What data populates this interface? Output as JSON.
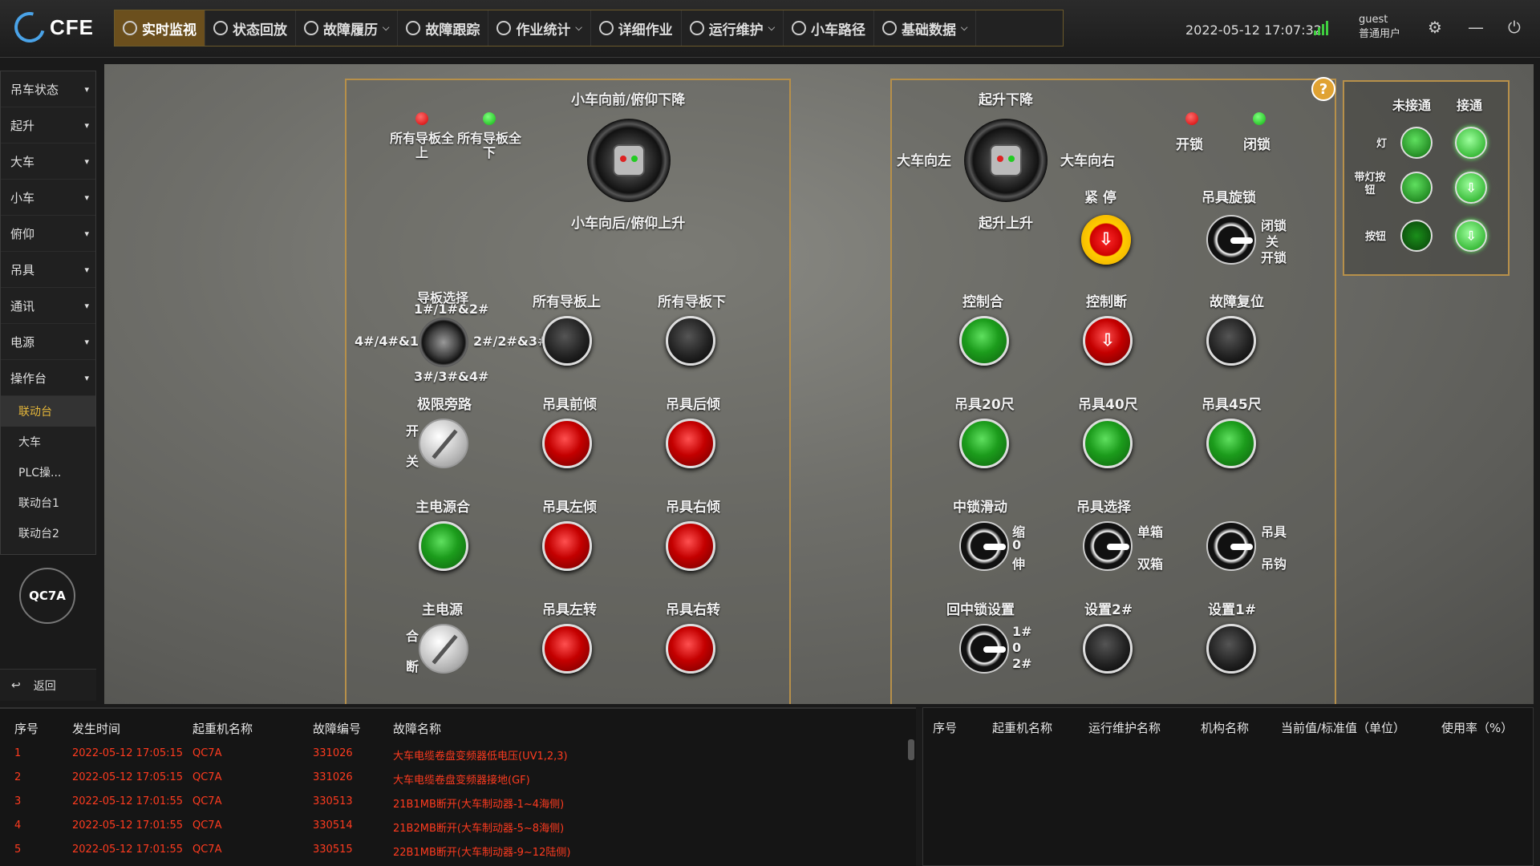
{
  "brand": {
    "logo_text": "CFE"
  },
  "nav": {
    "items": [
      {
        "label": "实时监视",
        "icon": "camera-icon",
        "active": true,
        "dropdown": false
      },
      {
        "label": "状态回放",
        "icon": "replay-icon",
        "active": false,
        "dropdown": false
      },
      {
        "label": "故障履历",
        "icon": "warning-icon",
        "active": false,
        "dropdown": true
      },
      {
        "label": "故障跟踪",
        "icon": "location-icon",
        "active": false,
        "dropdown": false
      },
      {
        "label": "作业统计",
        "icon": "chart-icon",
        "active": false,
        "dropdown": true
      },
      {
        "label": "详细作业",
        "icon": "list-icon",
        "active": false,
        "dropdown": false
      },
      {
        "label": "运行维护",
        "icon": "wrench-icon",
        "active": false,
        "dropdown": true
      },
      {
        "label": "小车路径",
        "icon": "path-icon",
        "active": false,
        "dropdown": false
      },
      {
        "label": "基础数据",
        "icon": "database-icon",
        "active": false,
        "dropdown": true
      }
    ]
  },
  "header": {
    "datetime": "2022-05-12 17:07:32",
    "user_name": "guest",
    "user_role": "普通用户"
  },
  "sidebar": {
    "items": [
      "吊车状态",
      "起升",
      "大车",
      "小车",
      "俯仰",
      "吊具",
      "通讯",
      "电源",
      "操作台"
    ],
    "subitems": [
      "联动台",
      "大车",
      "PLC操...",
      "联动台1",
      "联动台2"
    ],
    "crane": "QC7A",
    "back": "返回"
  },
  "left_panel": {
    "joystick_top": "小车向前/俯仰下降",
    "joystick_bottom": "小车向后/俯仰上升",
    "lamp1": "所有导板全上",
    "lamp2": "所有导板全下",
    "guide_select": "导板选择",
    "guide_pos_top": "1#/1#&2#",
    "guide_pos_left": "4#/4#&1#",
    "guide_pos_right": "2#/2#&3#",
    "guide_pos_bottom": "3#/3#&4#",
    "all_up": "所有导板上",
    "all_down": "所有导板下",
    "limit_bypass": "极限旁路",
    "open": "开",
    "close": "关",
    "spreader_front": "吊具前倾",
    "spreader_back": "吊具后倾",
    "main_power_on": "主电源合",
    "spreader_left_tilt": "吊具左倾",
    "spreader_right_tilt": "吊具右倾",
    "main_power": "主电源",
    "on": "合",
    "off": "断",
    "spreader_left_rot": "吊具左转",
    "spreader_right_rot": "吊具右转"
  },
  "right_panel": {
    "hoist_down": "起升下降",
    "hoist_up": "起升上升",
    "gantry_left": "大车向左",
    "gantry_right": "大车向右",
    "unlock": "开锁",
    "lock": "闭锁",
    "emergency": "紧 停",
    "twistlock": "吊具旋锁",
    "tl_lock": "闭锁",
    "tl_off": "关",
    "tl_open": "开锁",
    "ctrl_on": "控制合",
    "ctrl_off": "控制断",
    "fault_reset": "故障复位",
    "s20": "吊具20尺",
    "s40": "吊具40尺",
    "s45": "吊具45尺",
    "center_slide": "中锁滑动",
    "cs_shrink": "缩",
    "cs_zero": "0",
    "cs_extend": "伸",
    "spreader_select": "吊具选择",
    "single": "单箱",
    "double": "双箱",
    "sp": "吊具",
    "hook": "吊钩",
    "center_set": "回中锁设置",
    "p1": "1#",
    "p0": "0",
    "p2": "2#",
    "set2": "设置2#",
    "set1": "设置1#"
  },
  "legend": {
    "col_off": "未接通",
    "col_on": "接通",
    "row_lamp": "灯",
    "row_lit_button": "带灯按钮",
    "row_button": "按钮"
  },
  "fault_table": {
    "headers": [
      "序号",
      "发生时间",
      "起重机名称",
      "故障编号",
      "故障名称"
    ],
    "rows": [
      [
        "1",
        "2022-05-12 17:05:15",
        "QC7A",
        "331026",
        "大车电缆卷盘变频器低电压(UV1,2,3)"
      ],
      [
        "2",
        "2022-05-12 17:05:15",
        "QC7A",
        "331026",
        "大车电缆卷盘变频器接地(GF)"
      ],
      [
        "3",
        "2022-05-12 17:01:55",
        "QC7A",
        "330513",
        "21B1MB断开(大车制动器-1~4海侧)"
      ],
      [
        "4",
        "2022-05-12 17:01:55",
        "QC7A",
        "330514",
        "21B2MB断开(大车制动器-5~8海侧)"
      ],
      [
        "5",
        "2022-05-12 17:01:55",
        "QC7A",
        "330515",
        "22B1MB断开(大车制动器-9~12陆侧)"
      ]
    ]
  },
  "maint_table": {
    "headers": [
      "序号",
      "起重机名称",
      "运行维护名称",
      "机构名称",
      "当前值/标准值（单位）",
      "使用率（%）"
    ]
  }
}
